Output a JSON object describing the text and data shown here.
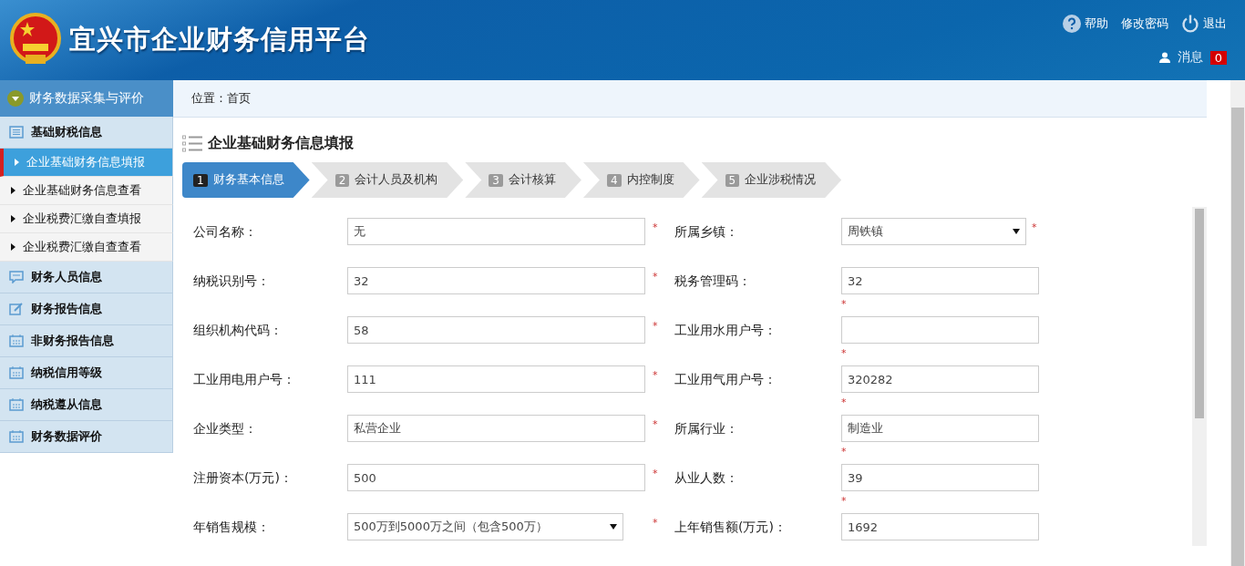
{
  "header": {
    "title": "宜兴市企业财务信用平台",
    "links": [
      {
        "kind": "help",
        "label": "帮助"
      },
      {
        "kind": "password",
        "label": "修改密码"
      },
      {
        "kind": "logout",
        "label": "退出"
      }
    ],
    "messages": {
      "label": "消息",
      "count": "0"
    }
  },
  "sidebar": {
    "title": "财务数据采集与评价",
    "items": [
      {
        "kind": "list",
        "label": "基础财税信息",
        "selected": false
      },
      {
        "kind": "sub",
        "label": "企业基础财务信息填报",
        "selected": true
      },
      {
        "kind": "sub",
        "label": "企业基础财务信息查看",
        "selected": false
      },
      {
        "kind": "sub",
        "label": "企业税费汇缴自查填报",
        "selected": false
      },
      {
        "kind": "sub",
        "label": "企业税费汇缴自查查看",
        "selected": false
      },
      {
        "kind": "chat",
        "label": "财务人员信息",
        "selected": false
      },
      {
        "kind": "edit",
        "label": "财务报告信息",
        "selected": false
      },
      {
        "kind": "calendar",
        "label": "非财务报告信息",
        "selected": false
      },
      {
        "kind": "calendar",
        "label": "纳税信用等级",
        "selected": false
      },
      {
        "kind": "calendar",
        "label": "纳税遵从信息",
        "selected": false
      },
      {
        "kind": "calendar",
        "label": "财务数据评价",
        "selected": false
      }
    ]
  },
  "breadcrumb": {
    "label": "位置：",
    "value": "首页"
  },
  "page_title": "企业基础财务信息填报",
  "steps": [
    {
      "number": "1",
      "label": "财务基本信息",
      "selected": true
    },
    {
      "number": "2",
      "label": "会计人员及机构",
      "selected": false
    },
    {
      "number": "3",
      "label": "会计核算",
      "selected": false
    },
    {
      "number": "4",
      "label": "内控制度",
      "selected": false
    },
    {
      "number": "5",
      "label": "企业涉税情况",
      "selected": false
    }
  ],
  "form_rows": [
    {
      "left": {
        "label": "公司名称：",
        "kind": "text",
        "value": "无",
        "mark": "*"
      },
      "right": {
        "label": "所属乡镇：",
        "kind": "select",
        "value": "周铁镇",
        "mark": "*"
      }
    },
    {
      "left": {
        "label": "纳税识别号：",
        "kind": "text",
        "value": "32",
        "mark": "*"
      },
      "right": {
        "label": "税务管理码：",
        "kind": "text",
        "value": "32",
        "mark": "*"
      }
    },
    {
      "left": {
        "label": "组织机构代码：",
        "kind": "text",
        "value": "58",
        "mark": "*"
      },
      "right": {
        "label": "工业用水用户号：",
        "kind": "text",
        "mark": "*"
      }
    },
    {
      "left": {
        "label": "工业用电用户号：",
        "kind": "text",
        "value": "111",
        "mark": "*"
      },
      "right": {
        "label": "工业用气用户号：",
        "kind": "text",
        "value": "320282",
        "mark": "*"
      }
    },
    {
      "left": {
        "label": "企业类型：",
        "kind": "text",
        "value": "私营企业",
        "mark": "*"
      },
      "right": {
        "label": "所属行业：",
        "kind": "text",
        "value": "制造业",
        "mark": "*"
      }
    },
    {
      "left": {
        "label": "注册资本(万元)：",
        "kind": "text",
        "value": "500",
        "mark": "*"
      },
      "right": {
        "label": "从业人数：",
        "kind": "text",
        "value": "39",
        "mark": "*"
      }
    },
    {
      "left": {
        "label": "年销售规模：",
        "kind": "select",
        "value": "500万到5000万之间（包含500万）",
        "mark": "*"
      },
      "right": {
        "label": "上年销售额(万元)：",
        "kind": "text",
        "value": "1692"
      }
    }
  ]
}
